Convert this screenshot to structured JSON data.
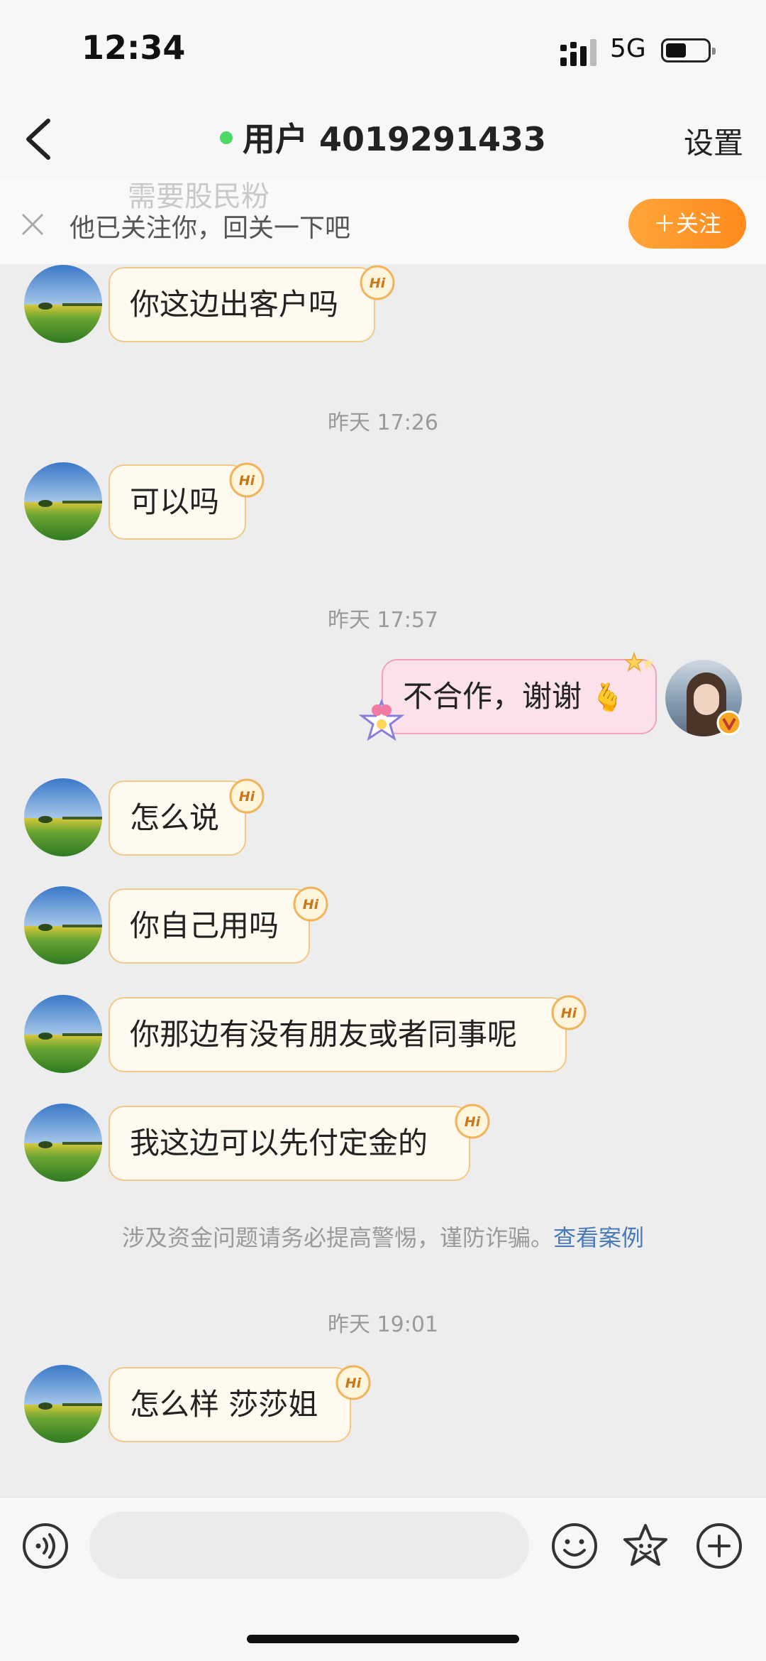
{
  "status_bar": {
    "time": "12:34",
    "network": "5G"
  },
  "nav": {
    "title": "用户 4019291433",
    "settings_label": "设置"
  },
  "follow_banner": {
    "ghost_text": "需要股民粉",
    "text": "他已关注你，回关一下吧",
    "follow_button": "＋关注"
  },
  "messages": [
    {
      "text": "你这边出客户吗"
    },
    {
      "timestamp": "昨天 17:26"
    },
    {
      "text": "可以吗"
    },
    {
      "timestamp": "昨天 17:57"
    },
    {
      "text": "不合作，谢谢",
      "emoji": "🫰"
    },
    {
      "text": "怎么说"
    },
    {
      "text": "你自己用吗"
    },
    {
      "text": "你那边有没有朋友或者同事呢"
    },
    {
      "text": "我这边可以先付定金的"
    },
    {
      "warning": "涉及资金问题请务必提高警惕，谨防诈骗。",
      "warning_link": "查看案例"
    },
    {
      "timestamp": "昨天 19:01"
    },
    {
      "text": "怎么样 莎莎姐"
    }
  ],
  "hi_badge_text": "Hi",
  "icons": [
    "back-icon",
    "close-icon",
    "voice-icon",
    "emoji-icon",
    "sticker-icon",
    "plus-icon",
    "verified-v-icon"
  ],
  "colors": {
    "accent_orange": "#ff8a1c",
    "online_green": "#4cd964",
    "incoming_bubble": "#fffaf0",
    "outgoing_bubble": "#fbe1e9",
    "link_blue": "#4a7ab8"
  }
}
